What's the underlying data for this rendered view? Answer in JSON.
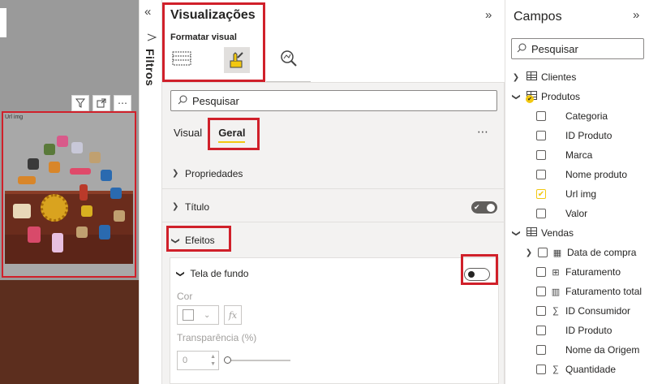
{
  "canvas": {
    "visual_label": "Url img",
    "toolbar": {
      "filter_icon": "filter-icon",
      "focus_icon": "focus-mode-icon",
      "more_label": "⋯"
    }
  },
  "filters_pane": {
    "label": "Filtros",
    "collapse_glyph": "«"
  },
  "visualizations": {
    "title": "Visualizações",
    "expand_glyph": "»",
    "subtitle": "Formatar visual",
    "search_placeholder": "Pesquisar",
    "tabs": [
      {
        "label": "Visual"
      },
      {
        "label": "Geral"
      }
    ],
    "more_label": "⋯",
    "sections": [
      {
        "label": "Propriedades",
        "expanded": false
      },
      {
        "label": "Título",
        "expanded": false,
        "toggle_on": true
      },
      {
        "label": "Efeitos",
        "expanded": true
      }
    ],
    "background_card": {
      "label": "Tela de fundo",
      "toggle_on": false,
      "color_label": "Cor",
      "fx_label": "fx",
      "transparency_label": "Transparência (%)",
      "transparency_value": "0"
    }
  },
  "fields": {
    "title": "Campos",
    "collapse_glyph": "»",
    "search_placeholder": "Pesquisar",
    "tables": [
      {
        "name": "Clientes",
        "expanded": false,
        "fields": []
      },
      {
        "name": "Produtos",
        "expanded": true,
        "fields": [
          {
            "name": "Categoria",
            "checked": false
          },
          {
            "name": "ID Produto",
            "checked": false
          },
          {
            "name": "Marca",
            "checked": false
          },
          {
            "name": "Nome produto",
            "checked": false
          },
          {
            "name": "Url img",
            "checked": true
          },
          {
            "name": "Valor",
            "checked": false
          }
        ]
      },
      {
        "name": "Vendas",
        "expanded": true,
        "fields": [
          {
            "name": "Data de compra",
            "icon": "calendar-icon"
          },
          {
            "name": "Faturamento",
            "icon": "measure-table-icon"
          },
          {
            "name": "Faturamento total",
            "icon": "calculator-icon"
          },
          {
            "name": "ID Consumidor",
            "icon": "sigma-icon"
          },
          {
            "name": "ID Produto",
            "icon": "none"
          },
          {
            "name": "Nome da Origem",
            "icon": "none"
          },
          {
            "name": "Quantidade",
            "icon": "sigma-icon"
          }
        ]
      }
    ]
  },
  "colors": {
    "highlight_red": "#d0202a",
    "accent_yellow": "#f2c811",
    "shelf_brown": "#6a2c1c"
  }
}
